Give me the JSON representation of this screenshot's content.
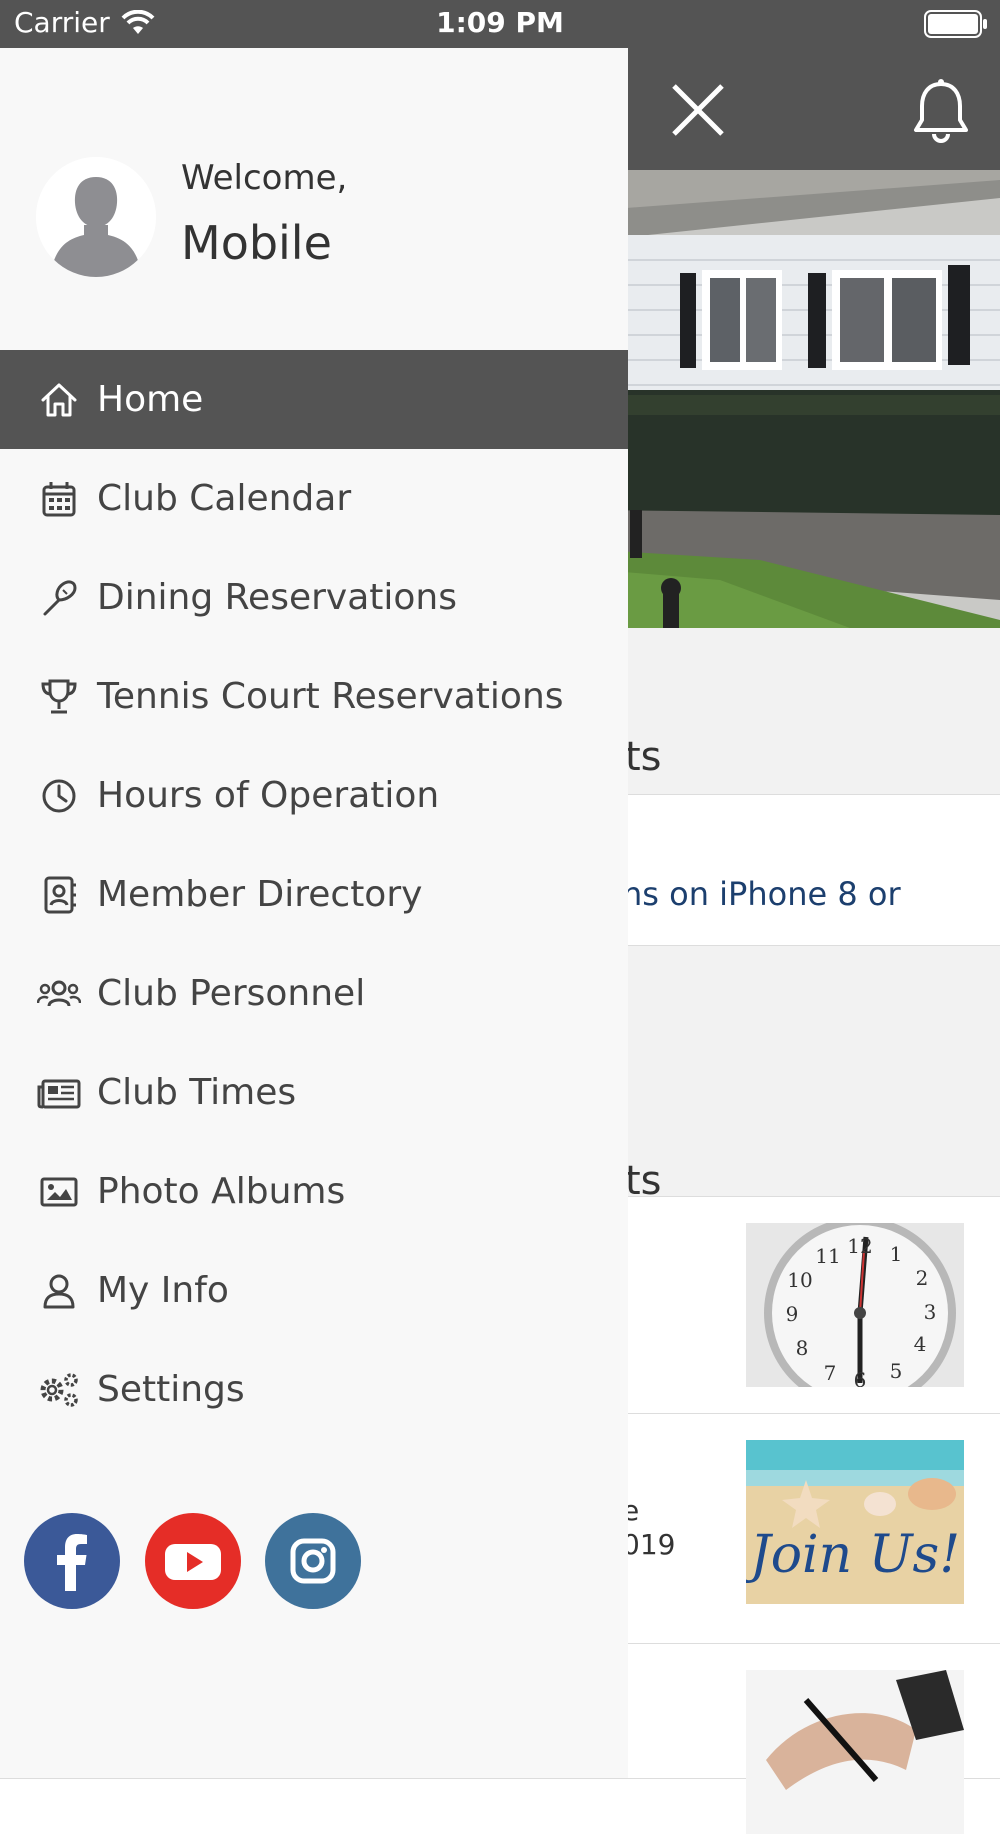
{
  "status_bar": {
    "carrier": "Carrier",
    "time": "1:09 PM"
  },
  "background": {
    "section_a_title": "ts",
    "news_text": "ns on iPhone 8 or",
    "section_b_title": "ts",
    "event2_line1": "e",
    "event2_line2": "019",
    "event2_image_text": "Join Us!"
  },
  "drawer": {
    "welcome": "Welcome,",
    "username": "Mobile",
    "menu": [
      {
        "label": "Home",
        "icon": "home-icon",
        "active": true
      },
      {
        "label": "Club Calendar",
        "icon": "calendar-icon"
      },
      {
        "label": "Dining Reservations",
        "icon": "utensils-icon"
      },
      {
        "label": "Tennis Court Reservations",
        "icon": "trophy-icon"
      },
      {
        "label": "Hours of Operation",
        "icon": "clock-icon"
      },
      {
        "label": "Member Directory",
        "icon": "address-book-icon"
      },
      {
        "label": "Club Personnel",
        "icon": "users-icon"
      },
      {
        "label": "Club Times",
        "icon": "newspaper-icon"
      },
      {
        "label": "Photo Albums",
        "icon": "image-icon"
      },
      {
        "label": "My Info",
        "icon": "user-icon"
      },
      {
        "label": "Settings",
        "icon": "cogs-icon"
      }
    ],
    "social": [
      "facebook-icon",
      "youtube-icon",
      "instagram-icon"
    ]
  },
  "colors": {
    "header": "#545454",
    "drawer_bg": "#f8f8f8",
    "facebook": "#3b5998",
    "youtube": "#e52d27",
    "instagram": "#3f729b"
  }
}
